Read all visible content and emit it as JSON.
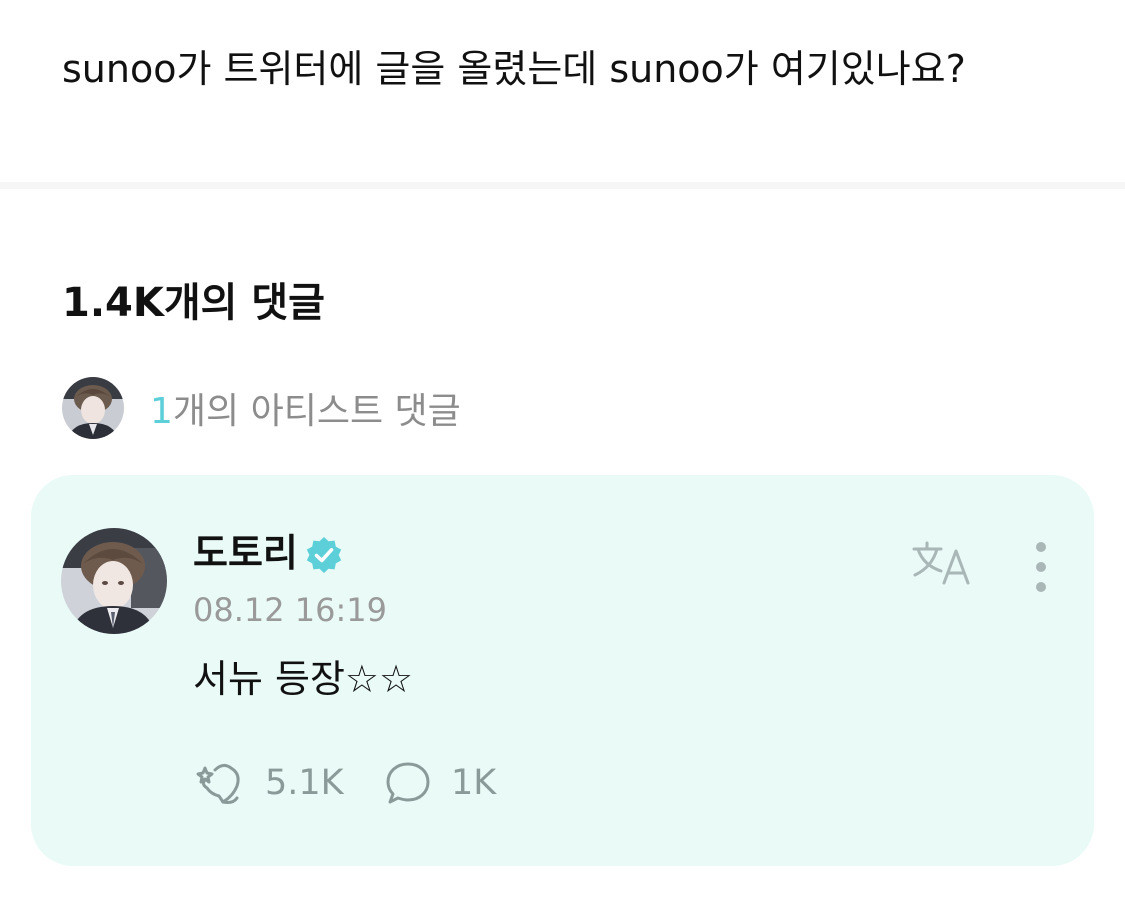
{
  "post": {
    "text": "sunoo가 트위터에 글을 올렸는데 sunoo가 여기있나요?"
  },
  "comments_section": {
    "heading": "1.4K개의 댓글",
    "artist_comments": {
      "count": "1",
      "label": "개의 아티스트 댓글"
    }
  },
  "comment": {
    "author": "도토리",
    "verified_icon": "verified-badge-icon",
    "timestamp": "08.12 16:19",
    "body": "서뉴 등장☆☆",
    "likes": "5.1K",
    "replies": "1K",
    "like_icon": "heart-sparkle-icon",
    "reply_icon": "speech-bubble-icon",
    "translate_icon": "translate-icon",
    "more_icon": "more-vertical-icon"
  },
  "colors": {
    "accent": "#5dcfd8",
    "card_background": "#e9faf7",
    "muted_text": "#8c8c8c",
    "stat_text": "#8a9a98",
    "icon_gray": "#a9b7b6"
  }
}
